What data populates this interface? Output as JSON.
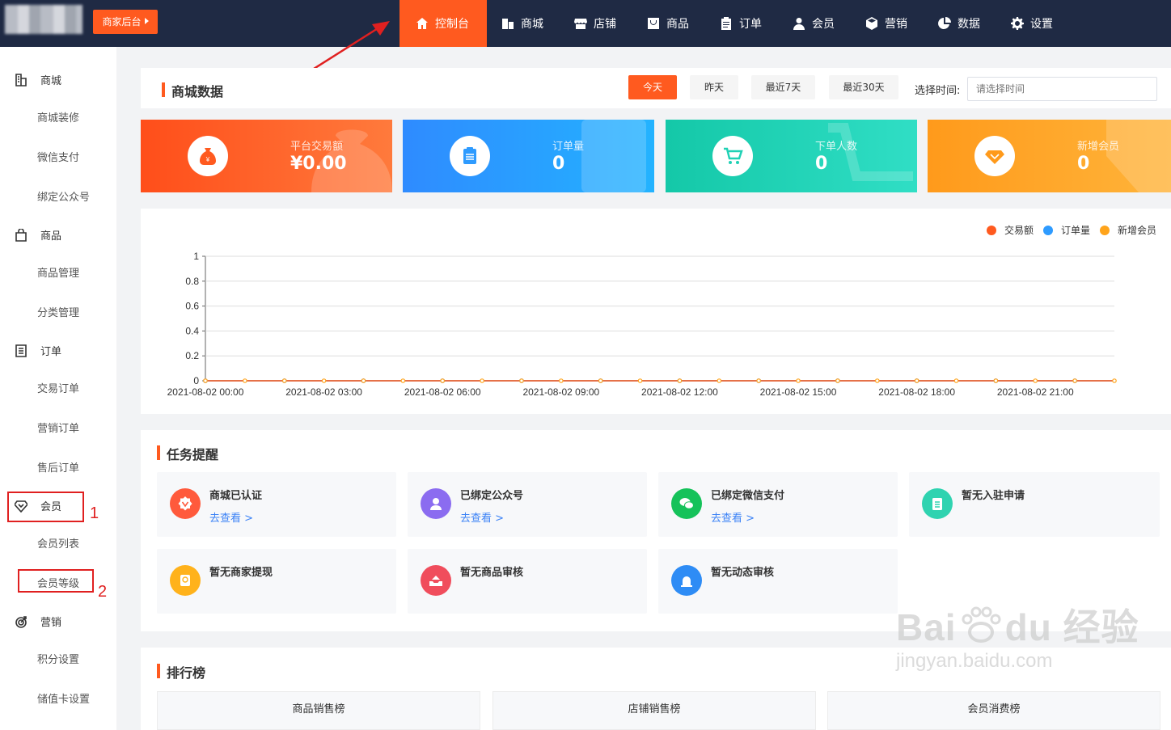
{
  "topbar": {
    "merchant_label": "商家后台",
    "nav": [
      {
        "label": "控制台",
        "icon": "home-icon"
      },
      {
        "label": "商城",
        "icon": "building-icon"
      },
      {
        "label": "店铺",
        "icon": "store-icon"
      },
      {
        "label": "商品",
        "icon": "bag-icon"
      },
      {
        "label": "订单",
        "icon": "clipboard-icon"
      },
      {
        "label": "会员",
        "icon": "user-icon"
      },
      {
        "label": "营销",
        "icon": "cube-icon"
      },
      {
        "label": "数据",
        "icon": "pie-icon"
      },
      {
        "label": "设置",
        "icon": "gear-icon"
      }
    ]
  },
  "sidebar": {
    "groups": [
      {
        "label": "商城",
        "icon": "building-icon",
        "items": [
          "商城装修",
          "微信支付",
          "绑定公众号"
        ]
      },
      {
        "label": "商品",
        "icon": "bag-icon",
        "items": [
          "商品管理",
          "分类管理"
        ]
      },
      {
        "label": "订单",
        "icon": "list-icon",
        "items": [
          "交易订单",
          "营销订单",
          "售后订单"
        ]
      },
      {
        "label": "会员",
        "icon": "diamond-icon",
        "items": [
          "会员列表",
          "会员等级"
        ]
      },
      {
        "label": "营销",
        "icon": "target-icon",
        "items": [
          "积分设置",
          "储值卡设置"
        ]
      }
    ],
    "annotations": [
      "1",
      "2"
    ]
  },
  "mall_data": {
    "title": "商城数据",
    "filters": [
      "今天",
      "昨天",
      "最近7天",
      "最近30天"
    ],
    "active_filter": "今天",
    "time_label": "选择时间:",
    "time_placeholder": "请选择时间"
  },
  "stats": [
    {
      "label": "平台交易额",
      "value": "¥0.00",
      "icon": "money-bag-icon",
      "color": "#ff5a1f"
    },
    {
      "label": "订单量",
      "value": "0",
      "icon": "clipboard-icon",
      "color": "#2e9bff"
    },
    {
      "label": "下单人数",
      "value": "0",
      "icon": "cart-icon",
      "color": "#1fd1b5"
    },
    {
      "label": "新增会员",
      "value": "0",
      "icon": "diamond-icon",
      "color": "#ffa41b"
    }
  ],
  "chart_data": {
    "type": "line",
    "x": [
      "2021-08-02 00:00",
      "2021-08-02 01:00",
      "2021-08-02 02:00",
      "2021-08-02 03:00",
      "2021-08-02 04:00",
      "2021-08-02 05:00",
      "2021-08-02 06:00",
      "2021-08-02 07:00",
      "2021-08-02 08:00",
      "2021-08-02 09:00",
      "2021-08-02 10:00",
      "2021-08-02 11:00",
      "2021-08-02 12:00",
      "2021-08-02 13:00",
      "2021-08-02 14:00",
      "2021-08-02 15:00",
      "2021-08-02 16:00",
      "2021-08-02 17:00",
      "2021-08-02 18:00",
      "2021-08-02 19:00",
      "2021-08-02 20:00",
      "2021-08-02 21:00",
      "2021-08-02 22:00",
      "2021-08-02 23:00"
    ],
    "x_tick_labels": [
      "2021-08-02 00:00",
      "2021-08-02 03:00",
      "2021-08-02 06:00",
      "2021-08-02 09:00",
      "2021-08-02 12:00",
      "2021-08-02 15:00",
      "2021-08-02 18:00",
      "2021-08-02 21:00"
    ],
    "y_ticks": [
      "0",
      "0.2",
      "0.4",
      "0.6",
      "0.8",
      "1"
    ],
    "ylim": [
      0,
      1
    ],
    "series": [
      {
        "name": "交易额",
        "color": "#ff5a1f",
        "values": [
          0,
          0,
          0,
          0,
          0,
          0,
          0,
          0,
          0,
          0,
          0,
          0,
          0,
          0,
          0,
          0,
          0,
          0,
          0,
          0,
          0,
          0,
          0,
          0
        ]
      },
      {
        "name": "订单量",
        "color": "#2e9bff",
        "values": [
          0,
          0,
          0,
          0,
          0,
          0,
          0,
          0,
          0,
          0,
          0,
          0,
          0,
          0,
          0,
          0,
          0,
          0,
          0,
          0,
          0,
          0,
          0,
          0
        ]
      },
      {
        "name": "新增会员",
        "color": "#ffa41b",
        "values": [
          0,
          0,
          0,
          0,
          0,
          0,
          0,
          0,
          0,
          0,
          0,
          0,
          0,
          0,
          0,
          0,
          0,
          0,
          0,
          0,
          0,
          0,
          0,
          0
        ]
      }
    ],
    "legend_position": "top-right",
    "grid": true
  },
  "tasks": {
    "title": "任务提醒",
    "items": [
      {
        "title": "商城已认证",
        "link": "去查看 >",
        "icon": "badge-icon",
        "color": "#ff5a3c"
      },
      {
        "title": "已绑定公众号",
        "link": "去查看 >",
        "icon": "user-icon",
        "color": "#8b6cf0"
      },
      {
        "title": "已绑定微信支付",
        "link": "去查看 >",
        "icon": "wechat-icon",
        "color": "#15c25a"
      },
      {
        "title": "暂无入驻申请",
        "link": "",
        "icon": "clipboard-icon",
        "color": "#2fd3b0"
      },
      {
        "title": "暂无商家提现",
        "link": "",
        "icon": "withdraw-icon",
        "color": "#ffb21b"
      },
      {
        "title": "暂无商品审核",
        "link": "",
        "icon": "tray-icon",
        "color": "#f04d5c"
      },
      {
        "title": "暂无动态审核",
        "link": "",
        "icon": "alarm-icon",
        "color": "#2e8cf5"
      }
    ]
  },
  "ranking": {
    "title": "排行榜",
    "tabs": [
      "商品销售榜",
      "店铺销售榜",
      "会员消费榜"
    ]
  },
  "watermark": {
    "line1": "Bai",
    "line2": "du",
    "line3": "经验",
    "url": "jingyan.baidu.com"
  }
}
